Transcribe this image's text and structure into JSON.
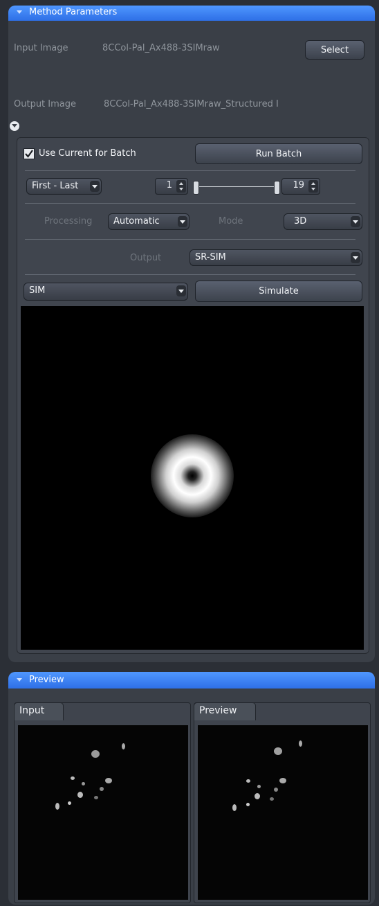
{
  "method_panel": {
    "title": "Method Parameters",
    "input_image_label": "Input Image",
    "input_image_value": "8CCol-Pal_Ax488-3SIMraw",
    "select_button": "Select",
    "output_image_label": "Output Image",
    "output_image_value": "8CCol-Pal_Ax488-3SIMraw_Structured I",
    "use_current_for_batch": {
      "label": "Use Current for Batch",
      "checked": true
    },
    "run_batch_button": "Run Batch",
    "range_dropdown": "First - Last",
    "range_start": "1",
    "range_end": "19",
    "processing_label": "Processing",
    "processing_value": "Automatic",
    "mode_label": "Mode",
    "mode_value": "3D",
    "output_label": "Output",
    "output_value": "SR-SIM",
    "sim_dropdown": "SIM",
    "simulate_button": "Simulate"
  },
  "preview_panel": {
    "title": "Preview",
    "tabs": [
      "Input",
      "Preview"
    ]
  },
  "colors": {
    "header_blue": "#3a7ff5",
    "panel_bg": "#3a3f47",
    "image_bg": "#000000"
  }
}
